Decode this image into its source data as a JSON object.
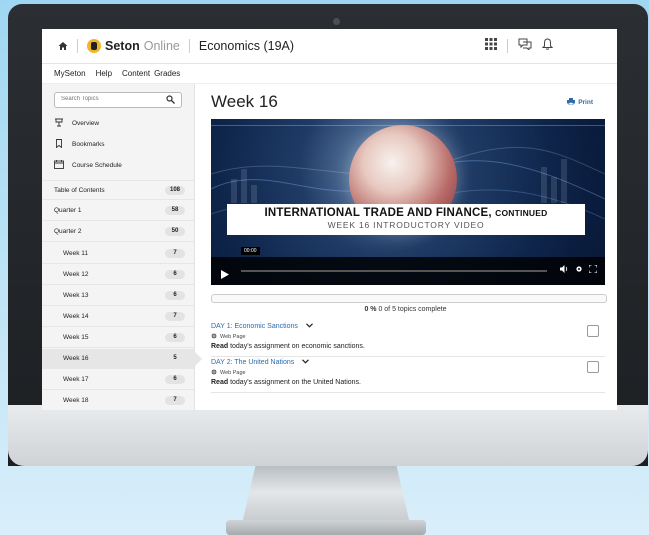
{
  "header": {
    "brand_bold": "Seton",
    "brand_light": "Online",
    "course_title": "Economics (19A)"
  },
  "nav": {
    "items": [
      "MySeton",
      "Help",
      "Content",
      "Grades"
    ]
  },
  "sidebar": {
    "search_placeholder": "Search Topics",
    "links": [
      {
        "label": "Overview",
        "icon": "overview-icon"
      },
      {
        "label": "Bookmarks",
        "icon": "bookmark-icon"
      },
      {
        "label": "Course Schedule",
        "icon": "calendar-icon"
      }
    ],
    "toc": [
      {
        "label": "Table of Contents",
        "count": "108"
      },
      {
        "label": "Quarter 1",
        "count": "58"
      },
      {
        "label": "Quarter 2",
        "count": "50"
      },
      {
        "label": "Week 11",
        "count": "7"
      },
      {
        "label": "Week 12",
        "count": "6"
      },
      {
        "label": "Week 13",
        "count": "6"
      },
      {
        "label": "Week 14",
        "count": "7"
      },
      {
        "label": "Week 15",
        "count": "6"
      },
      {
        "label": "Week 16",
        "count": "5"
      },
      {
        "label": "Week 17",
        "count": "6"
      },
      {
        "label": "Week 18",
        "count": "7"
      }
    ],
    "active": "Week 16"
  },
  "main": {
    "title": "Week 16",
    "print_label": "Print",
    "video": {
      "headline": "INTERNATIONAL TRADE AND FINANCE,",
      "headline_suffix": "CONTINUED",
      "subline": "WEEK 16 INTRODUCTORY VIDEO",
      "timecode": "00:00"
    },
    "progress": {
      "percent": "0 %",
      "text": "0 of 5 topics complete",
      "value": 0
    },
    "topics": [
      {
        "title": "DAY 1: Economic Sanctions",
        "type": "Web Page",
        "desc_bold": "Read",
        "desc_rest": "today's assignment on economic sanctions."
      },
      {
        "title": "DAY 2: The United Nations",
        "type": "Web Page",
        "desc_bold": "Read",
        "desc_rest": "today's assignment on the United Nations."
      }
    ]
  },
  "colors": {
    "link_blue": "#2a6bb0",
    "logo_gold": "#f1b52b",
    "sidebar_bg": "#f4f4f4"
  }
}
